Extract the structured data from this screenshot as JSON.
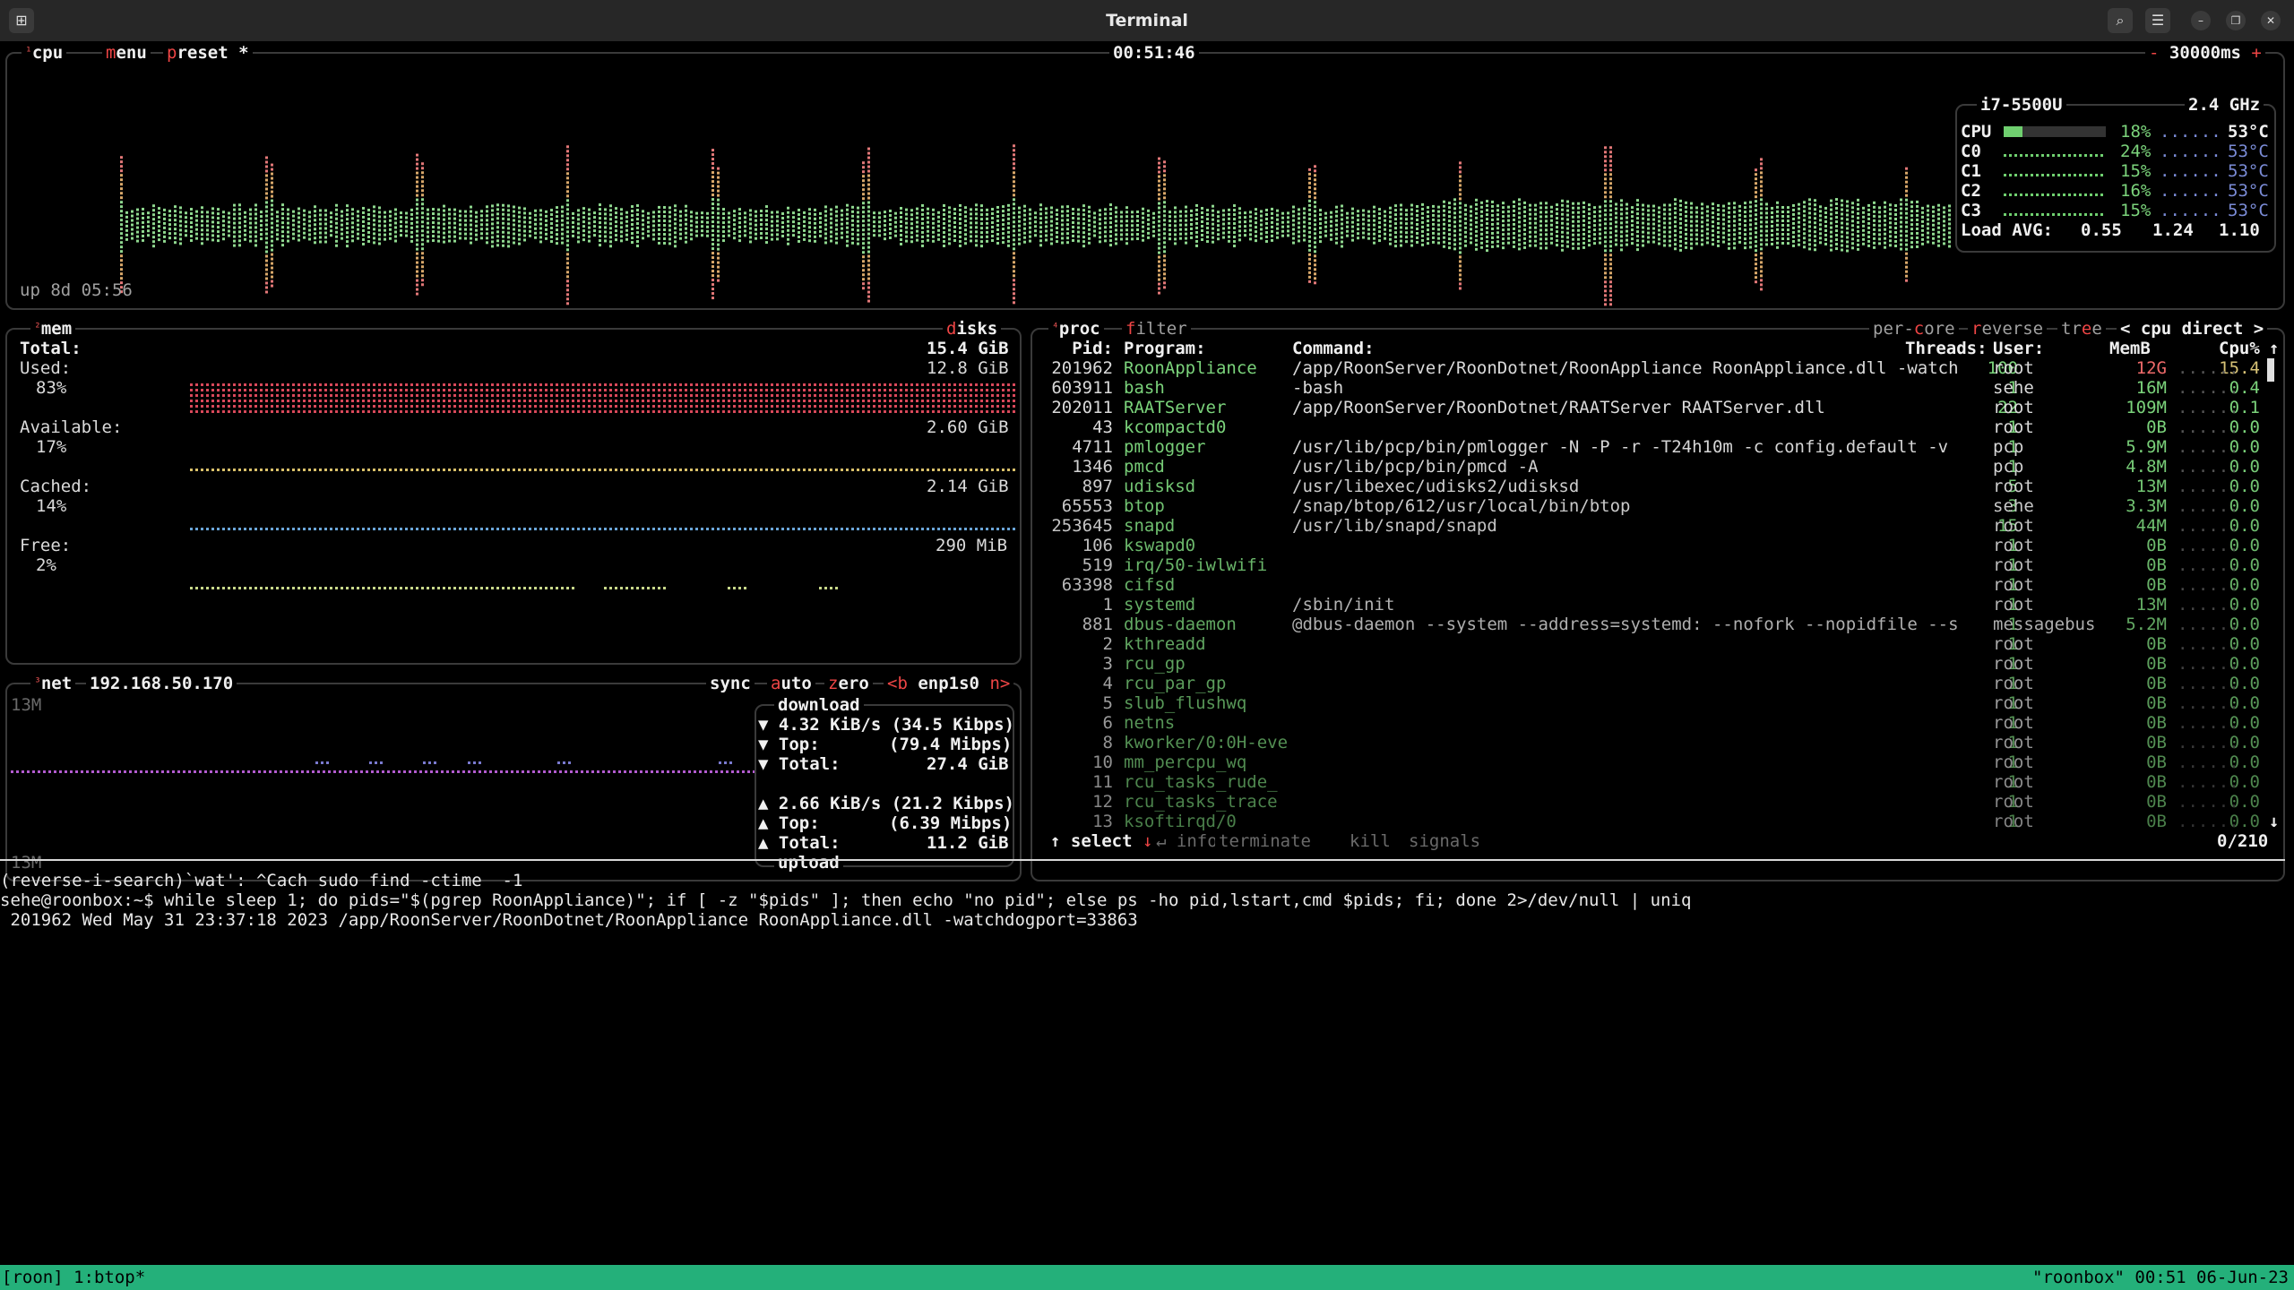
{
  "window": {
    "title": "Terminal"
  },
  "cpu_box": {
    "label_num": "¹",
    "label": "cpu",
    "menu": "menu",
    "preset": "preset *",
    "clock": "00:51:46",
    "interval": "30000ms",
    "minus": "-",
    "plus": "+",
    "uptime": "up 8d 05:56",
    "model": "i7-5500U",
    "freq": "2.4 GHz",
    "rows": [
      {
        "name": "CPU",
        "pct": "18%",
        "temp": "53°C",
        "level": 0.18
      },
      {
        "name": "C0",
        "pct": "24%",
        "temp": "53°C",
        "level": 0.24
      },
      {
        "name": "C1",
        "pct": "15%",
        "temp": "53°C",
        "level": 0.15
      },
      {
        "name": "C2",
        "pct": "16%",
        "temp": "53°C",
        "level": 0.16
      },
      {
        "name": "C3",
        "pct": "15%",
        "temp": "53°C",
        "level": 0.15
      }
    ],
    "load_label": "Load AVG:",
    "load1": "0.55",
    "load5": "1.24",
    "load15": "1.10"
  },
  "mem_box": {
    "label_num": "²",
    "label": "mem",
    "disks": "disks",
    "total_label": "Total:",
    "total": "15.4 GiB",
    "used_label": "Used:",
    "used_pct": "83%",
    "used": "12.8 GiB",
    "avail_label": "Available:",
    "avail_pct": "17%",
    "avail": "2.60 GiB",
    "cached_label": "Cached:",
    "cached_pct": "14%",
    "cached": "2.14 GiB",
    "free_label": "Free:",
    "free_pct": "2%",
    "free": "290 MiB"
  },
  "net_box": {
    "label_num": "³",
    "label": "net",
    "ip": "192.168.50.170",
    "sync": "sync",
    "auto": "auto",
    "zero": "zero",
    "prev": "<b",
    "iface": "enp1s0",
    "next": "n>",
    "scale_top": "13M",
    "scale_bottom": "13M",
    "download": "download",
    "upload": "upload",
    "dl_rate": "4.32 KiB/s (34.5 Kibps)",
    "dl_top_label": "Top:",
    "dl_top": "(79.4 Mibps)",
    "dl_total_label": "Total:",
    "dl_total": "27.4 GiB",
    "ul_rate": "2.66 KiB/s (21.2 Kibps)",
    "ul_top_label": "Top:",
    "ul_top": "(6.39 Mibps)",
    "ul_total_label": "Total:",
    "ul_total": "11.2 GiB"
  },
  "proc_box": {
    "label_num": "⁴",
    "label": "proc",
    "filter": "filter",
    "per_core": "per-core",
    "reverse": "reverse",
    "tree": "tree",
    "sort": "< cpu direct >",
    "headers": {
      "pid": "Pid:",
      "program": "Program:",
      "command": "Command:",
      "threads": "Threads:",
      "user": "User:",
      "mem": "MemB",
      "cpu": "Cpu%"
    },
    "rows": [
      {
        "pid": "201962",
        "program": "RoonAppliance",
        "command": "/app/RoonServer/RoonDotnet/RoonAppliance RoonAppliance.dll -watch",
        "threads": "100",
        "user": "root",
        "mem": "12G",
        "cpu": "15.4"
      },
      {
        "pid": "603911",
        "program": "bash",
        "command": "-bash",
        "threads": "1",
        "user": "sehe",
        "mem": "16M",
        "cpu": "0.4"
      },
      {
        "pid": "202011",
        "program": "RAATServer",
        "command": "/app/RoonServer/RoonDotnet/RAATServer RAATServer.dll",
        "threads": "22",
        "user": "root",
        "mem": "109M",
        "cpu": "0.1"
      },
      {
        "pid": "43",
        "program": "kcompactd0",
        "command": "",
        "threads": "1",
        "user": "root",
        "mem": "0B",
        "cpu": "0.0"
      },
      {
        "pid": "4711",
        "program": "pmlogger",
        "command": "/usr/lib/pcp/bin/pmlogger -N -P -r -T24h10m -c config.default -v",
        "threads": "1",
        "user": "pcp",
        "mem": "5.9M",
        "cpu": "0.0"
      },
      {
        "pid": "1346",
        "program": "pmcd",
        "command": "/usr/lib/pcp/bin/pmcd -A",
        "threads": "1",
        "user": "pcp",
        "mem": "4.8M",
        "cpu": "0.0"
      },
      {
        "pid": "897",
        "program": "udisksd",
        "command": "/usr/libexec/udisks2/udisksd",
        "threads": "5",
        "user": "root",
        "mem": "13M",
        "cpu": "0.0"
      },
      {
        "pid": "65553",
        "program": "btop",
        "command": "/snap/btop/612/usr/local/bin/btop",
        "threads": "3",
        "user": "sehe",
        "mem": "3.3M",
        "cpu": "0.0"
      },
      {
        "pid": "253645",
        "program": "snapd",
        "command": "/usr/lib/snapd/snapd",
        "threads": "15",
        "user": "root",
        "mem": "44M",
        "cpu": "0.0"
      },
      {
        "pid": "106",
        "program": "kswapd0",
        "command": "",
        "threads": "1",
        "user": "root",
        "mem": "0B",
        "cpu": "0.0"
      },
      {
        "pid": "519",
        "program": "irq/50-iwlwifi",
        "command": "",
        "threads": "1",
        "user": "root",
        "mem": "0B",
        "cpu": "0.0"
      },
      {
        "pid": "63398",
        "program": "cifsd",
        "command": "",
        "threads": "1",
        "user": "root",
        "mem": "0B",
        "cpu": "0.0"
      },
      {
        "pid": "1",
        "program": "systemd",
        "command": "/sbin/init",
        "threads": "1",
        "user": "root",
        "mem": "13M",
        "cpu": "0.0"
      },
      {
        "pid": "881",
        "program": "dbus-daemon",
        "command": "@dbus-daemon --system --address=systemd: --nofork --nopidfile --s",
        "threads": "1",
        "user": "messagebus",
        "mem": "5.2M",
        "cpu": "0.0"
      },
      {
        "pid": "2",
        "program": "kthreadd",
        "command": "",
        "threads": "1",
        "user": "root",
        "mem": "0B",
        "cpu": "0.0"
      },
      {
        "pid": "3",
        "program": "rcu_gp",
        "command": "",
        "threads": "1",
        "user": "root",
        "mem": "0B",
        "cpu": "0.0"
      },
      {
        "pid": "4",
        "program": "rcu_par_gp",
        "command": "",
        "threads": "1",
        "user": "root",
        "mem": "0B",
        "cpu": "0.0"
      },
      {
        "pid": "5",
        "program": "slub_flushwq",
        "command": "",
        "threads": "1",
        "user": "root",
        "mem": "0B",
        "cpu": "0.0"
      },
      {
        "pid": "6",
        "program": "netns",
        "command": "",
        "threads": "1",
        "user": "root",
        "mem": "0B",
        "cpu": "0.0"
      },
      {
        "pid": "8",
        "program": "kworker/0:0H-eve",
        "command": "",
        "threads": "1",
        "user": "root",
        "mem": "0B",
        "cpu": "0.0"
      },
      {
        "pid": "10",
        "program": "mm_percpu_wq",
        "command": "",
        "threads": "1",
        "user": "root",
        "mem": "0B",
        "cpu": "0.0"
      },
      {
        "pid": "11",
        "program": "rcu_tasks_rude_",
        "command": "",
        "threads": "1",
        "user": "root",
        "mem": "0B",
        "cpu": "0.0"
      },
      {
        "pid": "12",
        "program": "rcu_tasks_trace",
        "command": "",
        "threads": "1",
        "user": "root",
        "mem": "0B",
        "cpu": "0.0"
      },
      {
        "pid": "13",
        "program": "ksoftirqd/0",
        "command": "",
        "threads": "1",
        "user": "root",
        "mem": "0B",
        "cpu": "0.0"
      }
    ],
    "footer": {
      "select": "select",
      "info": "info",
      "terminate": "terminate",
      "kill": "kill",
      "signals": "signals",
      "count": "0/210"
    }
  },
  "shell": {
    "line1": "(reverse-i-search)`wat': ^Cach sudo find -ctime  -1",
    "line2": "sehe@roonbox:~$ while sleep 1; do pids=\"$(pgrep RoonAppliance)\"; if [ -z \"$pids\" ]; then echo \"no pid\"; else ps -ho pid,lstart,cmd $pids; fi; done 2>/dev/null | uniq",
    "line3": " 201962 Wed May 31 23:37:18 2023 /app/RoonServer/RoonDotnet/RoonAppliance RoonAppliance.dll -watchdogport=33863"
  },
  "tmux": {
    "left": "[roon] 1:btop*",
    "right": "\"roonbox\" 00:51 06-Jun-23"
  }
}
